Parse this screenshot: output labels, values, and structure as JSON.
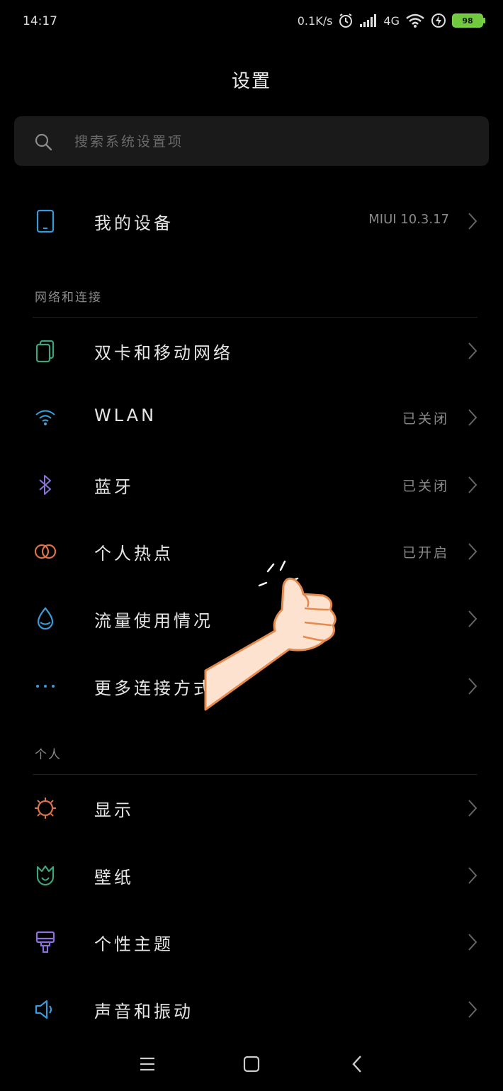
{
  "status_bar": {
    "time": "14:17",
    "net_speed": "0.1K/s",
    "network": "4G",
    "battery": "98"
  },
  "header": {
    "title": "设置"
  },
  "search": {
    "placeholder": "搜索系统设置项"
  },
  "device": {
    "label": "我的设备",
    "value": "MIUI 10.3.17"
  },
  "network_section": {
    "title": "网络和连接",
    "items": [
      {
        "label": "双卡和移动网络",
        "value": "",
        "icon": "sim-card-icon",
        "color": "#3fa37e"
      },
      {
        "label": "WLAN",
        "value": "已关闭",
        "icon": "wifi-icon",
        "color": "#3aa3d8"
      },
      {
        "label": "蓝牙",
        "value": "已关闭",
        "icon": "bluetooth-icon",
        "color": "#8a72d8"
      },
      {
        "label": "个人热点",
        "value": "已开启",
        "icon": "hotspot-icon",
        "color": "#d8734a"
      },
      {
        "label": "流量使用情况",
        "value": "",
        "icon": "data-usage-icon",
        "color": "#3a9ad8"
      },
      {
        "label": "更多连接方式",
        "value": "",
        "icon": "more-icon",
        "color": "#3a9ad8"
      }
    ]
  },
  "personal_section": {
    "title": "个人",
    "items": [
      {
        "label": "显示",
        "icon": "display-icon",
        "color": "#d8734a"
      },
      {
        "label": "壁纸",
        "icon": "wallpaper-icon",
        "color": "#3fa37e"
      },
      {
        "label": "个性主题",
        "icon": "theme-icon",
        "color": "#8a72d8"
      },
      {
        "label": "声音和振动",
        "icon": "sound-icon",
        "color": "#3a9ad8"
      }
    ]
  },
  "nav_bar": {
    "menu_icon": "menu-icon",
    "home_icon": "home-icon",
    "back_icon": "back-icon"
  }
}
